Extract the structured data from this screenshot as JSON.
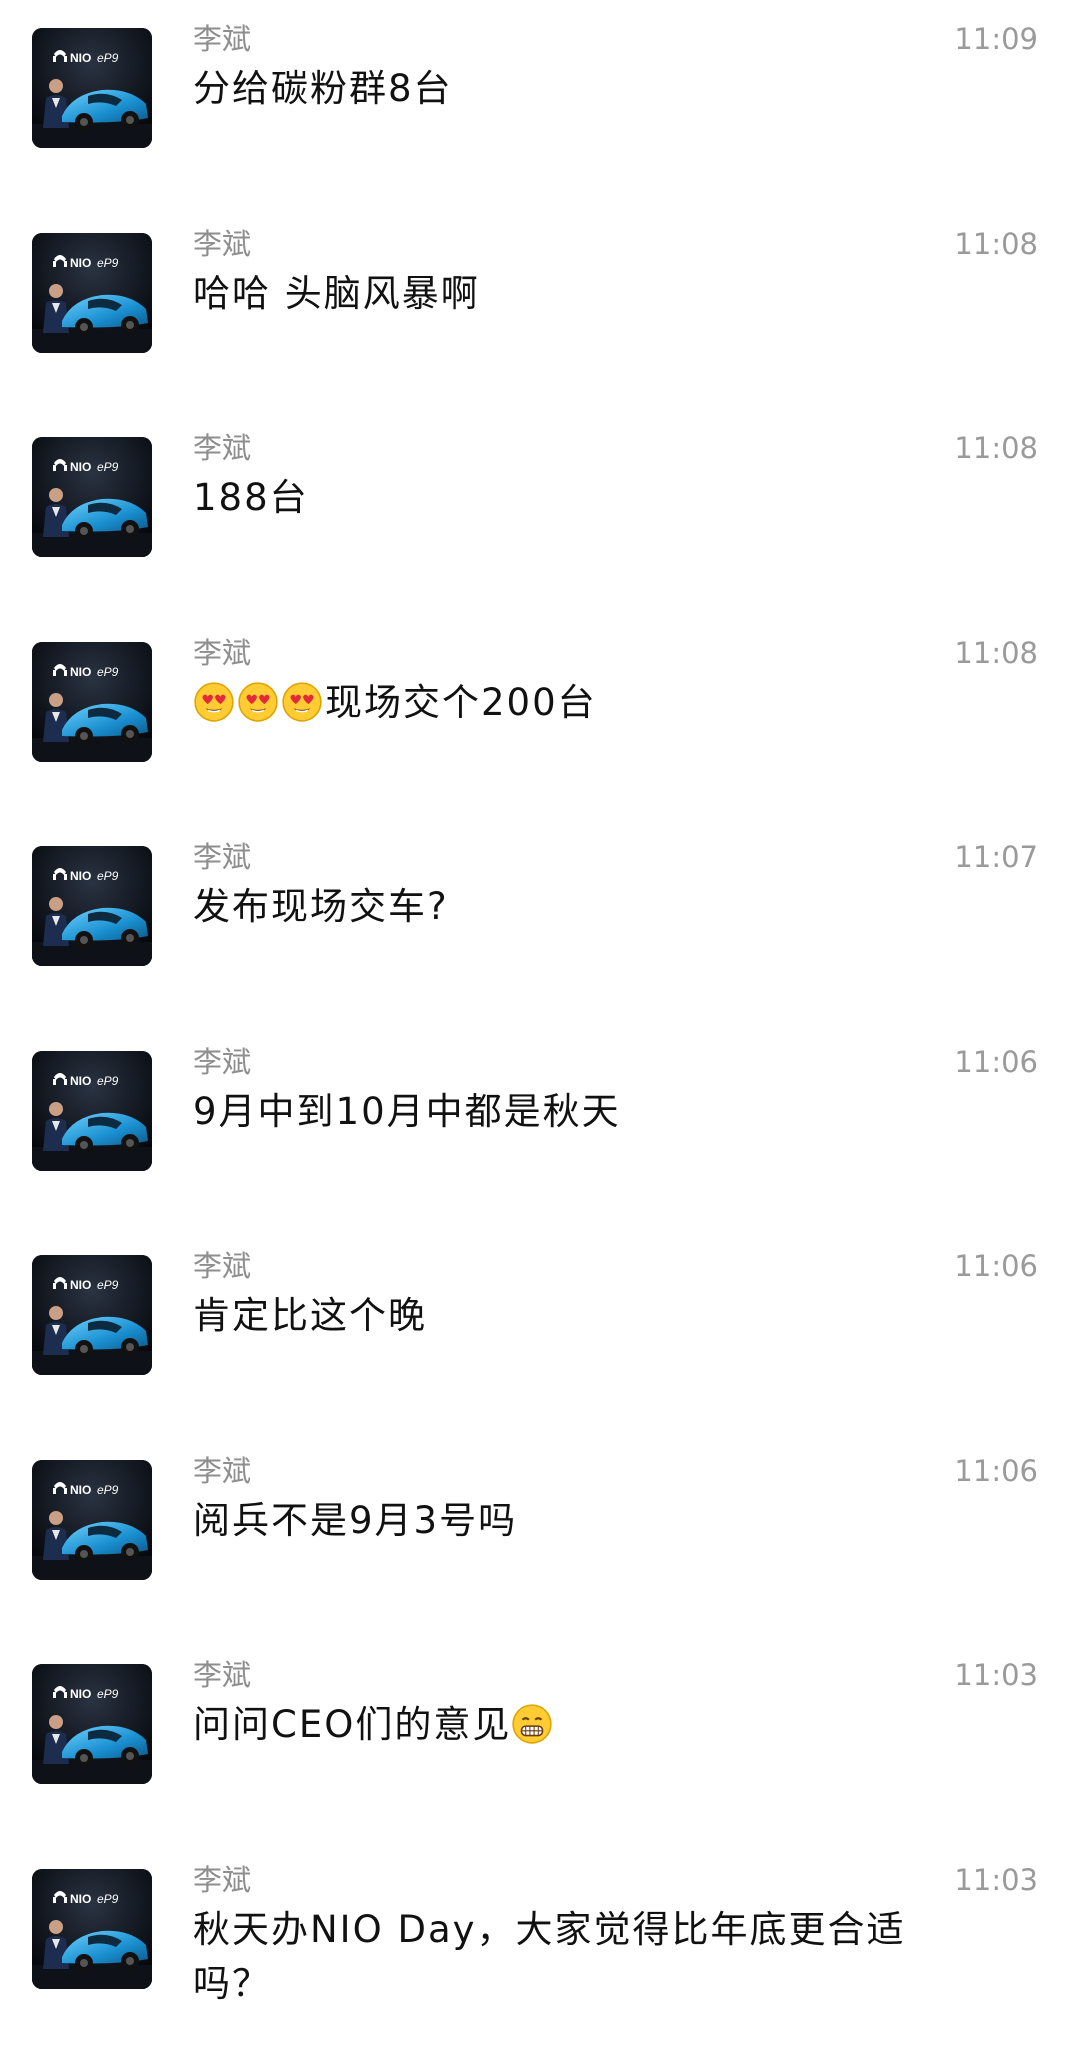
{
  "messages": [
    {
      "sender": "李斌",
      "time": "11:09",
      "text": "分给碳粉群8台",
      "emoji_before": [],
      "emoji_after": []
    },
    {
      "sender": "李斌",
      "time": "11:08",
      "text": "哈哈 头脑风暴啊",
      "emoji_before": [],
      "emoji_after": []
    },
    {
      "sender": "李斌",
      "time": "11:08",
      "text": "188台",
      "emoji_before": [],
      "emoji_after": []
    },
    {
      "sender": "李斌",
      "time": "11:08",
      "text": "现场交个200台",
      "emoji_before": [
        "heart-eyes-emoji",
        "heart-eyes-emoji",
        "heart-eyes-emoji"
      ],
      "emoji_after": []
    },
    {
      "sender": "李斌",
      "time": "11:07",
      "text": "发布现场交车?",
      "emoji_before": [],
      "emoji_after": []
    },
    {
      "sender": "李斌",
      "time": "11:06",
      "text": "9月中到10月中都是秋天",
      "emoji_before": [],
      "emoji_after": []
    },
    {
      "sender": "李斌",
      "time": "11:06",
      "text": "肯定比这个晚",
      "emoji_before": [],
      "emoji_after": []
    },
    {
      "sender": "李斌",
      "time": "11:06",
      "text": "阅兵不是9月3号吗",
      "emoji_before": [],
      "emoji_after": []
    },
    {
      "sender": "李斌",
      "time": "11:03",
      "text": "问问CEO们的意见",
      "emoji_before": [],
      "emoji_after": [
        "grin-emoji"
      ]
    },
    {
      "sender": "李斌",
      "time": "11:03",
      "text": "秋天办NIO Day，大家觉得比年底更合适吗？",
      "emoji_before": [],
      "emoji_after": []
    }
  ],
  "avatar": {
    "brand_text": "NIO",
    "model_text": "eP9",
    "car_color": "#1fa3e0"
  }
}
